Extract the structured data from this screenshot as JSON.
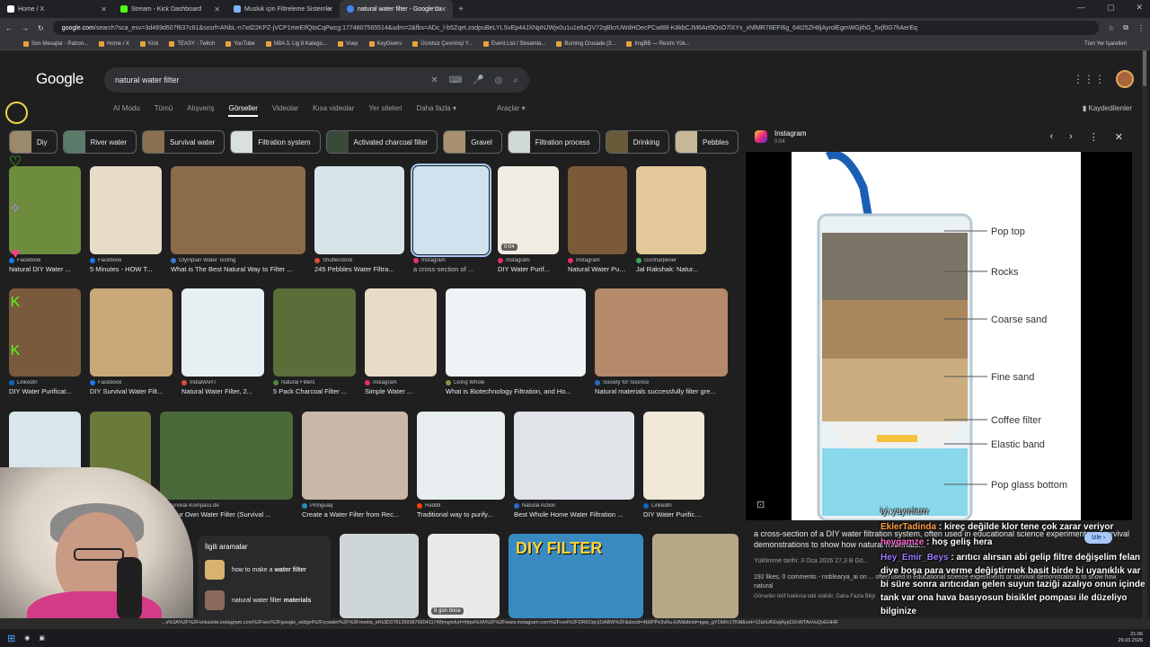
{
  "browser": {
    "tabs": [
      {
        "label": "Home / X",
        "color": "#ffffff",
        "active": false
      },
      {
        "label": "Stream - Kick Dashboard",
        "color": "#53fc18",
        "active": false
      },
      {
        "label": "Musluk için Filtreleme Sistemle",
        "color": "#7ab4ff",
        "active": false
      },
      {
        "label": "natural water filter - Google'da",
        "color": "#4285f4",
        "active": true
      }
    ],
    "new_tab": "+",
    "url_host": "google.com",
    "url_path": "/search?sca_esv=3d469d607f637c81&sxsrf=ANbL-n7xd22KPZ-jVCP1meEIfQtoCqPwcg:1774807565514&udm=2&fbs=ADc_l-b5Zqet.zodpuBeLYLSvEp44JXNpNJWjx0u1u1e6xQV72qBlcrUWdHOecPCw88l-K8kbCJM6Art9OsO7lXYx_xNfMR78EFI6g_64t25ZH8jAyrolEgmWGjthG_5vjf0G7hAerEq"
  },
  "bookmarks": [
    "Son Mesajlar - Patron...",
    "Home / X",
    "Kick",
    "TEASY - Twitch",
    "YouTube",
    "NBA 3. Lig 8 Katego...",
    "Voep",
    "KeyGivers",
    "Ücretsiz Çevrimiçi Y...",
    "Event List / Streamla...",
    "Burning Crusade (3...",
    "ImgBB — Resim Yük..."
  ],
  "bookmarks_all": "Tüm Yer İşaretleri",
  "google": {
    "logo": "Google",
    "query": "natural water filter",
    "filters": [
      "AI Modu",
      "Tümü",
      "Alışveriş",
      "Görseller",
      "Videolar",
      "Kısa videolar",
      "Yer siteleri",
      "Daha fazla ▾"
    ],
    "selected_filter": "Görseller",
    "tools": "Araçlar ▾",
    "saved": "Kaydedilenler",
    "chips": [
      "Diy",
      "River water",
      "Survival water",
      "Filtration system",
      "Activated charcoal filter",
      "Gravel",
      "Filtration process",
      "Drinking",
      "Pebbles"
    ]
  },
  "results": {
    "row1": [
      {
        "src": "Facebook",
        "cap": "Natural DIY Water ...",
        "src_color": "#1877f2",
        "bg": "#6d8c3e"
      },
      {
        "src": "Facebook",
        "cap": "5 Minutes - HOW T...",
        "src_color": "#1877f2",
        "bg": "#e6dcc8"
      },
      {
        "src": "Olympian Water Testing",
        "cap": "What is The Best Natural Way to Filter ...",
        "src_color": "#3a7bd5",
        "bg": "#8a6b4a"
      },
      {
        "src": "Shutterstock",
        "cap": "245 Pebbles Water Filtra...",
        "src_color": "#e04b3a",
        "bg": "#d6e4e8"
      },
      {
        "src": "Instagram",
        "cap": "a cross-section of ...",
        "src_color": "#e1306c",
        "bg": "#cfe3ee",
        "badge": ""
      },
      {
        "src": "Instagram",
        "cap": "DIY Water Purif...",
        "src_color": "#e1306c",
        "bg": "#f0ece2",
        "badge": "0:04"
      },
      {
        "src": "Instagram",
        "cap": "Natural Water Purif...",
        "src_color": "#e1306c",
        "bg": "#7a5a38"
      },
      {
        "src": "GoSharpener",
        "cap": "Jal Rakshak: Natur...",
        "src_color": "#3aa757",
        "bg": "#e3c99a"
      }
    ],
    "row2": [
      {
        "src": "LinkedIn",
        "cap": "DIY Water Purificat...",
        "src_color": "#0a66c2",
        "bg": "#7a5a3c"
      },
      {
        "src": "Facebook",
        "cap": "DIY Survival Water Filt...",
        "src_color": "#1877f2",
        "bg": "#c8a878"
      },
      {
        "src": "IndiaMART",
        "cap": "Natural Water Filter, 2...",
        "src_color": "#e04b3a",
        "bg": "#e6f0f2"
      },
      {
        "src": "Natural Filters",
        "cap": "5 Pack Charcoal Filter ...",
        "src_color": "#4a8a3a",
        "bg": "#5a6e3a"
      },
      {
        "src": "Instagram",
        "cap": "Simple Water ...",
        "src_color": "#e1306c",
        "bg": "#e8dcc8"
      },
      {
        "src": "Living Whole",
        "cap": "What is Biotechnology Filtration, and Ho...",
        "src_color": "#7a9a3a",
        "bg": "#eef3f6"
      },
      {
        "src": "Society for Science",
        "cap": "Natural materials successfully filter gre...",
        "src_color": "#2a6ac2",
        "bg": "#b48a6a"
      }
    ],
    "row3": [
      {
        "src": "",
        "cap": "",
        "src_color": "#888888",
        "bg": "#d8e6ee"
      },
      {
        "src": "",
        "cap": "",
        "src_color": "#888888",
        "bg": "#6a7a3a"
      },
      {
        "src": "Survival-Kompass.de",
        "cap": "...r Your Own Water Filter (Survival ...",
        "src_color": "#5a8a3a",
        "bg": "#4a6a3a"
      },
      {
        "src": "Pinnguaq",
        "cap": "Create a Water Filter from Rec...",
        "src_color": "#2a8ac2",
        "bg": "#c8b8a8"
      },
      {
        "src": "Reddit",
        "cap": "Traditional way to purify...",
        "src_color": "#ff4500",
        "bg": "#e8eef0"
      },
      {
        "src": "Natural Action",
        "cap": "Best Whole Home Water Filtration ...",
        "src_color": "#2a6ac2",
        "bg": "#e0e4e8"
      },
      {
        "src": "LinkedIn",
        "cap": "DIY Water Purificat...",
        "src_color": "#0a66c2",
        "bg": "#f0e8d8"
      }
    ],
    "row4": [
      {
        "src": "",
        "cap": "",
        "bg": "#cfd6d8"
      },
      {
        "src": "",
        "cap": "",
        "bg": "#e8eae8",
        "badge": "8 gün önce"
      },
      {
        "src": "",
        "cap": "",
        "bg": "#3a8ac2",
        "overlay": "DIY FILTER"
      },
      {
        "src": "",
        "cap": "",
        "bg": "#b8a888"
      }
    ]
  },
  "related": {
    "title": "İlgili aramalar",
    "items": [
      {
        "prefix": "how to make a ",
        "bold": "water filter"
      },
      {
        "prefix": "natural water filter ",
        "bold": "materials"
      }
    ]
  },
  "panel": {
    "source": "Instagram",
    "time": "0:04",
    "diagram_labels": [
      "Pop top",
      "Rocks",
      "Coarse sand",
      "Fine sand",
      "Coffee filter",
      "Elastic band",
      "Pop glass bottom"
    ],
    "title": "a cross-section of a DIY water filtration system, often used in educational science experiments or survival demonstrations to show how natural materials...",
    "meta": "Yüklenme tarihi: 3 Oca 2026   27,3 B Gö...",
    "stats": "192 likes, 0 comments - noblearya_ai on ... often used in educational science experiments or survival demonstrations to show how natural",
    "rights": "Görseller telif hakkına tabi olabilir. Daha Fazla Bilgi",
    "visit": "İzle ›"
  },
  "chat": [
    {
      "user": "",
      "text": "iyi yayınlarrr",
      "cls": "dim"
    },
    {
      "user": "EklerTadinda",
      "text": "kireç değilde klor tene çok zarar veriyor",
      "cls": "u1"
    },
    {
      "user": "heygamze",
      "text": "hoş geliş hera",
      "cls": "u2"
    },
    {
      "user": "Hey_Emir_Beys",
      "text": "arıtıcı alırsan abi gelip filtre değişelim felan diye boşa para verme değiştirmek basit birde bi uyanıklık var bi süre sonra arıtıcıdan gelen suyun taziği azalıyo onun içinde tank var ona hava basıyosun bisiklet pompası ile düzeliyo bilginize",
      "cls": "u3"
    }
  ],
  "status_url": "...s%3A%2F%2Fookaside.instagram.com%2Fseo%2Fgoogle_widget%2Fcrawler%2F%3Fmedia_id%3D3781399387660411748imgrefurl=https%3A%2F%2Fwww.instagram.com%2Freel%2FDR6Oqn1DABW%2F&docid=4b5PPe3vRu-EIM&tbnid=pgw_gYObRr1TKM&vet=12ahUKEwjAypO2cWTAnVuQvEHHR",
  "taskbar": {
    "clock": "21:06",
    "date": "29.03.2026"
  }
}
